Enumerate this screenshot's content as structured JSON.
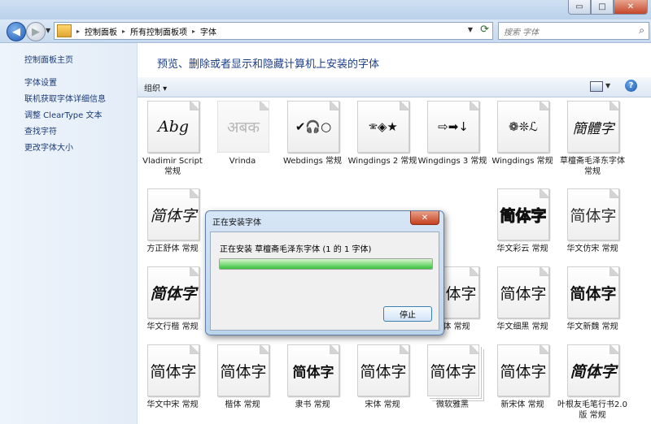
{
  "window": {
    "controls": {
      "minimize": "▭",
      "maximize": "□",
      "close": "✕"
    }
  },
  "nav": {
    "breadcrumbs": [
      "控制面板",
      "所有控制面板项",
      "字体"
    ],
    "search_placeholder": "搜索 字体"
  },
  "sidebar": {
    "home": "控制面板主页",
    "links": [
      "字体设置",
      "联机获取字体详细信息",
      "调整 ClearType 文本",
      "查找字符",
      "更改字体大小"
    ]
  },
  "main": {
    "heading": "预览、删除或者显示和隐藏计算机上安装的字体",
    "organize_label": "组织 ▾",
    "help": "?"
  },
  "fonts": [
    {
      "sample": "Abg",
      "name": "Vladimir Script 常规"
    },
    {
      "sample": "अबक",
      "name": "Vrinda"
    },
    {
      "sample": "✔🎧○",
      "name": "Webdings 常规"
    },
    {
      "sample": "🕾◈★",
      "name": "Wingdings 2 常规"
    },
    {
      "sample": "⇨➡↓",
      "name": "Wingdings 3 常规"
    },
    {
      "sample": "❁❊ℒ",
      "name": "Wingdings 常规"
    },
    {
      "sample": "簡體字",
      "name": "草檀斋毛泽东字体 常规"
    },
    {
      "sample": "简体字",
      "name": "方正舒体 常规"
    },
    {
      "sample": "简体字",
      "name": "华文彩云 常规"
    },
    {
      "sample": "简体字",
      "name": "华文仿宋 常规"
    },
    {
      "sample": "简体字",
      "name": "华文行楷 常规"
    },
    {
      "sample": "简体字",
      "name": "宋体 常规"
    },
    {
      "sample": "简体字",
      "name": "华文细黑 常规"
    },
    {
      "sample": "简体字",
      "name": "华文新魏 常规"
    },
    {
      "sample": "简体字",
      "name": "华文中宋 常规"
    },
    {
      "sample": "简体字",
      "name": "楷体 常规"
    },
    {
      "sample": "简体字",
      "name": "隶书 常规"
    },
    {
      "sample": "简体字",
      "name": "宋体 常规"
    },
    {
      "sample": "简体字",
      "name": "微软雅黑"
    },
    {
      "sample": "简体字",
      "name": "新宋体 常规"
    },
    {
      "sample": "简体字",
      "name": "叶根友毛笔行书2.0版 常规"
    }
  ],
  "dialog": {
    "title": "正在安装字体",
    "message": "正在安装 草檀斋毛泽东字体 (1 的 1 字体)",
    "stop_label": "停止",
    "close": "✕",
    "progress": 1.0
  },
  "colors": {
    "heading": "#1e3f8a",
    "link": "#1b3b75",
    "progress": "#37c23a"
  }
}
